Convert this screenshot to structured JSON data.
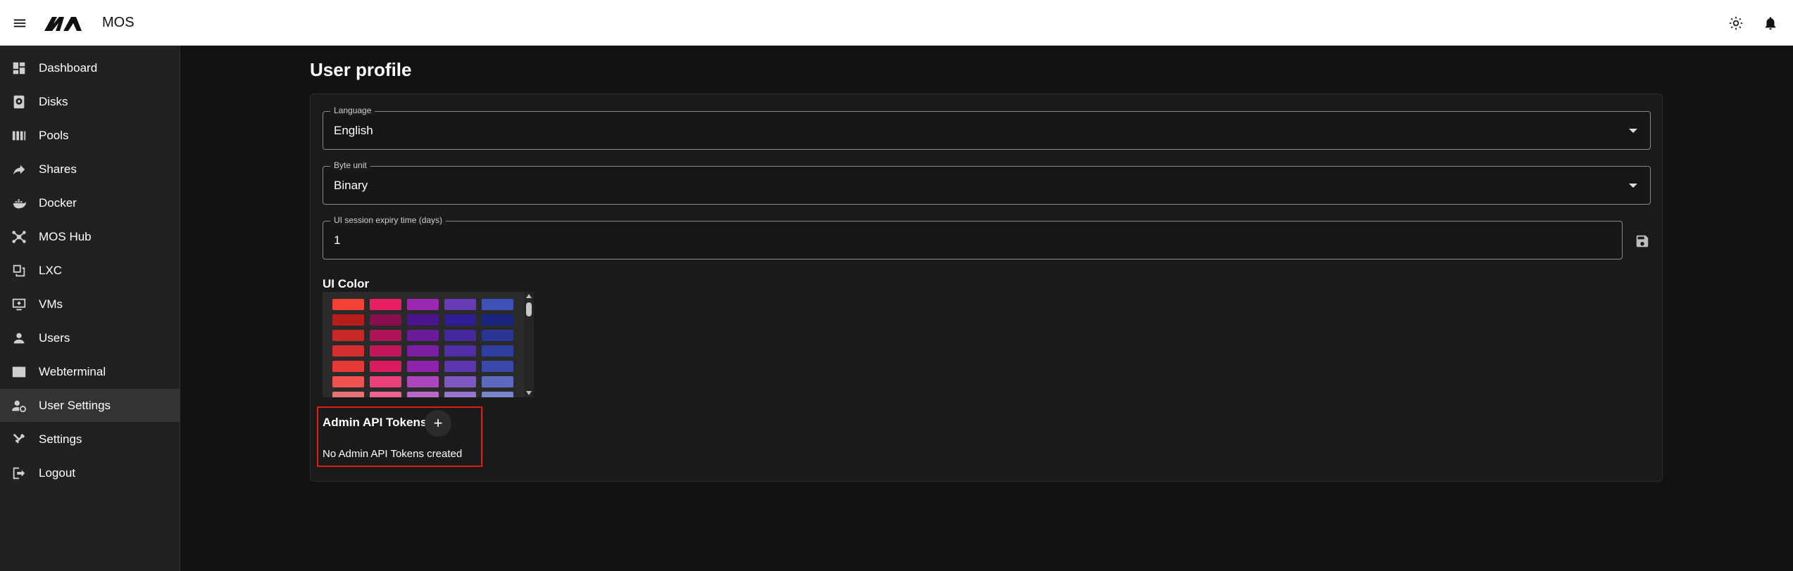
{
  "app": {
    "title": "MOS"
  },
  "sidebar": {
    "items": [
      {
        "label": "Dashboard",
        "icon": "dashboard-icon"
      },
      {
        "label": "Disks",
        "icon": "disk-icon"
      },
      {
        "label": "Pools",
        "icon": "pools-icon"
      },
      {
        "label": "Shares",
        "icon": "share-icon"
      },
      {
        "label": "Docker",
        "icon": "docker-icon"
      },
      {
        "label": "MOS Hub",
        "icon": "hub-icon"
      },
      {
        "label": "LXC",
        "icon": "lxc-icon"
      },
      {
        "label": "VMs",
        "icon": "vm-icon"
      },
      {
        "label": "Users",
        "icon": "user-icon"
      },
      {
        "label": "Webterminal",
        "icon": "terminal-icon"
      },
      {
        "label": "User Settings",
        "icon": "user-settings-icon",
        "active": true
      },
      {
        "label": "Settings",
        "icon": "settings-icon"
      },
      {
        "label": "Logout",
        "icon": "logout-icon"
      }
    ]
  },
  "main": {
    "title": "User profile",
    "language": {
      "label": "Language",
      "value": "English"
    },
    "byte_unit": {
      "label": "Byte unit",
      "value": "Binary"
    },
    "session_expiry": {
      "label": "UI session expiry time (days)",
      "value": "1"
    },
    "ui_color": {
      "heading": "UI Color",
      "columns": [
        [
          "#f44336",
          "#b71c1c",
          "#c62828",
          "#d32f2f",
          "#e53935",
          "#ef5350",
          "#e57373"
        ],
        [
          "#e91e63",
          "#880e4f",
          "#ad1457",
          "#c2185b",
          "#d81b60",
          "#ec407a",
          "#f06292"
        ],
        [
          "#9c27b0",
          "#4a148c",
          "#6a1b9a",
          "#7b1fa2",
          "#8e24aa",
          "#ab47bc",
          "#ba68c8"
        ],
        [
          "#673ab7",
          "#311b92",
          "#4527a0",
          "#512da8",
          "#5e35b1",
          "#7e57c2",
          "#9575cd"
        ],
        [
          "#3f51b5",
          "#1a237e",
          "#283593",
          "#303f9f",
          "#3949ab",
          "#5c6bc0",
          "#7986cb"
        ]
      ]
    },
    "api_tokens": {
      "heading": "Admin API Tokens",
      "add_label": "+",
      "empty_text": "No Admin API Tokens created"
    }
  },
  "colors": {
    "highlight": "#e01919",
    "background": "#121212",
    "sidebar": "#212121"
  }
}
